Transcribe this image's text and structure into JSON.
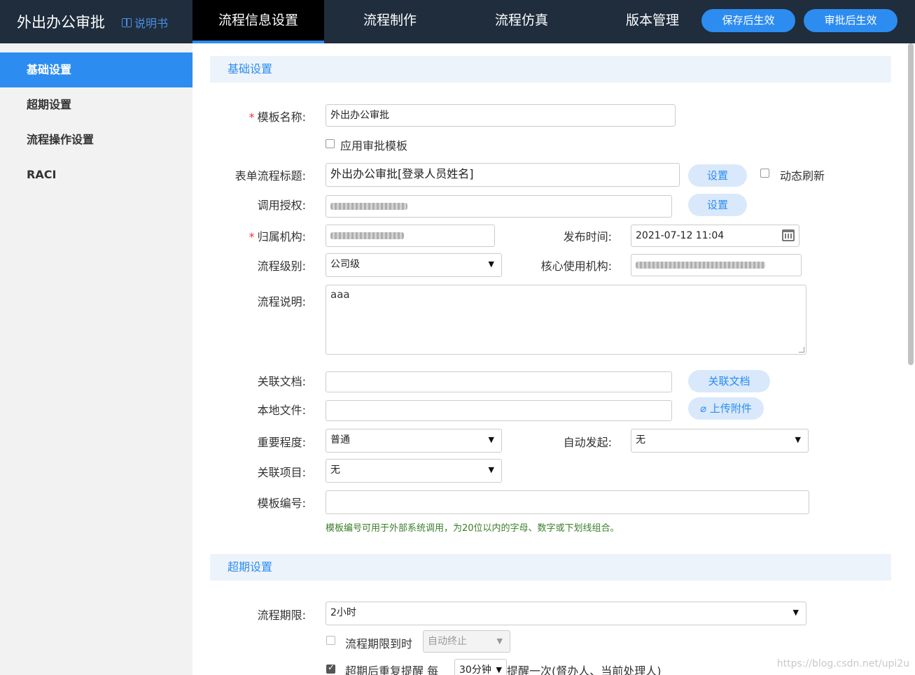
{
  "header": {
    "app_title": "外出办公审批",
    "manual_label": "说明书",
    "tabs": [
      "流程信息设置",
      "流程制作",
      "流程仿真",
      "版本管理"
    ],
    "active_tab": "流程信息设置",
    "save_button": "保存后生效",
    "approve_button": "审批后生效"
  },
  "sidebar": {
    "items": [
      {
        "label": "基础设置",
        "active": true
      },
      {
        "label": "超期设置",
        "active": false
      },
      {
        "label": "流程操作设置",
        "active": false
      },
      {
        "label": "RACI",
        "active": false
      }
    ]
  },
  "basic": {
    "section_title": "基础设置",
    "template_name_label": "模板名称:",
    "template_name_value": "外出办公审批",
    "apply_template_label": "应用审批模板",
    "form_title_label": "表单流程标题:",
    "form_title_value": "外出办公审批[登录人员姓名]",
    "set_button": "设置",
    "dynamic_refresh_label": "动态刷新",
    "authorization_label": "调用授权:",
    "org_label": "归属机构:",
    "publish_time_label": "发布时间:",
    "publish_time_value": "2021-07-12 11:04",
    "level_label": "流程级别:",
    "level_value": "公司级",
    "core_org_label": "核心使用机构:",
    "description_label": "流程说明:",
    "description_value": "aaa",
    "related_doc_label": "关联文档:",
    "related_doc_button": "关联文档",
    "local_file_label": "本地文件:",
    "upload_button": "上传附件",
    "importance_label": "重要程度:",
    "importance_value": "普通",
    "auto_start_label": "自动发起:",
    "auto_start_value": "无",
    "related_project_label": "关联项目:",
    "related_project_value": "无",
    "template_code_label": "模板编号:",
    "template_code_hint": "模板编号可用于外部系统调用，为20位以内的字母、数字或下划线组合。"
  },
  "overdue": {
    "section_title": "超期设置",
    "deadline_label": "流程期限:",
    "deadline_value": "2小时",
    "deadline_reached_label": "流程期限到时",
    "deadline_action_value": "自动终止",
    "repeat_label_prefix": "超期后重复提醒 每",
    "repeat_interval_value": "30分钟",
    "repeat_label_suffix": "提醒一次(督办人、当前处理人)"
  },
  "watermark": "https://blog.csdn.net/upi2u",
  "colors": {
    "accent": "#2d8cf0",
    "topbar": "#1f2d3d",
    "hint": "#3a7d2a"
  }
}
